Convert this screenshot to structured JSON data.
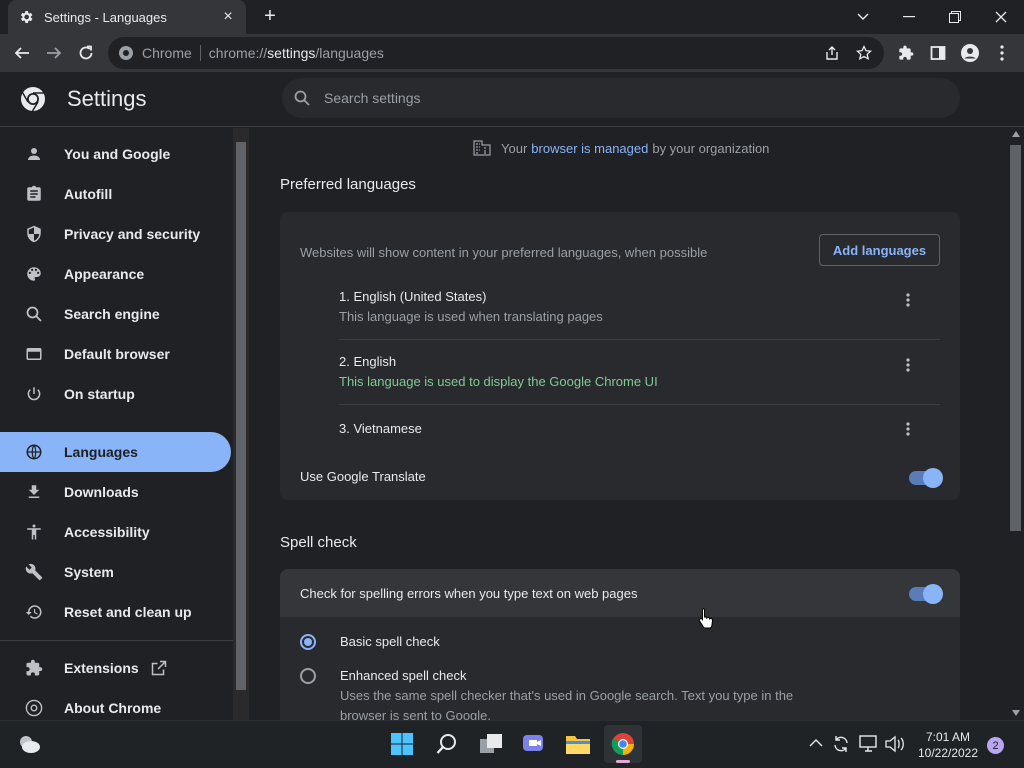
{
  "tab": {
    "title": "Settings - Languages",
    "close": "×"
  },
  "newtab": "+",
  "window": {
    "minimize": "—",
    "restore": "❐",
    "close": "✕",
    "tabsearch": "⌄"
  },
  "omnibox": {
    "site": "Chrome",
    "url_scheme": "chrome://",
    "url_host": "settings",
    "url_path": "/languages"
  },
  "header": {
    "title": "Settings",
    "search_placeholder": "Search settings"
  },
  "sidebar": {
    "items": [
      {
        "label": "You and Google",
        "icon": "person-icon"
      },
      {
        "label": "Autofill",
        "icon": "clipboard-icon"
      },
      {
        "label": "Privacy and security",
        "icon": "shield-icon"
      },
      {
        "label": "Appearance",
        "icon": "palette-icon"
      },
      {
        "label": "Search engine",
        "icon": "search-icon"
      },
      {
        "label": "Default browser",
        "icon": "browser-icon"
      },
      {
        "label": "On startup",
        "icon": "power-icon"
      },
      {
        "label": "Languages",
        "icon": "globe-icon"
      },
      {
        "label": "Downloads",
        "icon": "download-icon"
      },
      {
        "label": "Accessibility",
        "icon": "accessibility-icon"
      },
      {
        "label": "System",
        "icon": "wrench-icon"
      },
      {
        "label": "Reset and clean up",
        "icon": "history-icon"
      },
      {
        "label": "Extensions",
        "icon": "puzzle-icon"
      },
      {
        "label": "About Chrome",
        "icon": "chrome-icon"
      }
    ]
  },
  "managed": {
    "pre": "Your",
    "link": "browser is managed",
    "post": "by your organization"
  },
  "preferred": {
    "heading": "Preferred languages",
    "description": "Websites will show content in your preferred languages, when possible",
    "add_button": "Add languages",
    "languages": [
      {
        "name": "1. English (United States)",
        "sub": "This language is used when translating pages"
      },
      {
        "name": "2. English",
        "sub": "This language is used to display the Google Chrome UI"
      },
      {
        "name": "3. Vietnamese",
        "sub": ""
      }
    ],
    "translate_label": "Use Google Translate",
    "translate_on": true
  },
  "spell": {
    "heading": "Spell check",
    "toggle_label": "Check for spelling errors when you type text on web pages",
    "toggle_on": true,
    "basic_label": "Basic spell check",
    "enhanced_label": "Enhanced spell check",
    "enhanced_desc_1": "Uses the same spell checker that's used in Google search. Text you type in the",
    "enhanced_desc_2": "browser is sent to Google.",
    "selected": "basic"
  },
  "taskbar": {
    "time": "7:01 AM",
    "date": "10/22/2022",
    "notifications": "2"
  },
  "colors": {
    "accent": "#8ab4f8",
    "green": "#81c995",
    "background": "#202124",
    "card": "#292a2d"
  }
}
